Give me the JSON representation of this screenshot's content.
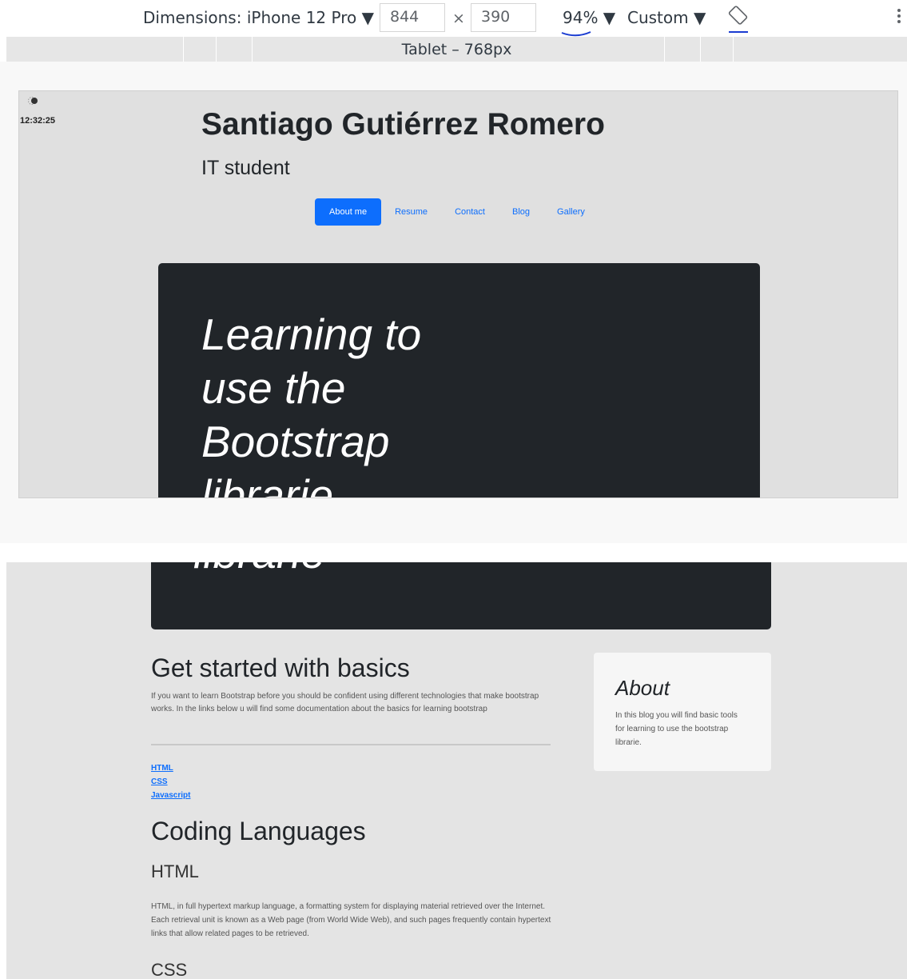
{
  "devtools": {
    "dimensions_label": "Dimensions: iPhone 12 Pro ▼",
    "width_value": "844",
    "times": "×",
    "height_value": "390",
    "zoom_label": "94% ▼",
    "throttle_label": "Custom ▼",
    "media_query_label": "Tablet – 768px",
    "rotate_icon": "rotate-icon",
    "more_icon": "more-vertical-icon",
    "annotation_color": "#1a3cd1"
  },
  "overlay": {
    "time": "12:32:25",
    "icon": "moon-toggle-icon"
  },
  "site": {
    "name": "Santiago Gutiérrez Romero",
    "subtitle": "IT student",
    "nav": [
      {
        "label": "About me",
        "active": true
      },
      {
        "label": "Resume"
      },
      {
        "label": "Contact"
      },
      {
        "label": "Blog"
      },
      {
        "label": "Gallery"
      }
    ],
    "accent": "#0d6efd",
    "hero_text": "Learning to use the Bootstrap librarie",
    "hero_overflow_text": "librarie",
    "hero_bg": "#212529"
  },
  "main": {
    "post_title": "Get started with basics",
    "post_body": "If you want to learn Bootstrap before you should be confident using different technologies that make bootstrap works. In the links below u will find some documentation about the basics for learning bootstrap",
    "links": [
      "HTML",
      "CSS",
      "Javascript"
    ],
    "section_title": "Coding Languages",
    "languages": [
      {
        "title": "HTML",
        "body": "HTML, in full hypertext markup language, a formatting system for displaying material retrieved over the Internet. Each retrieval unit is known as a Web page (from World Wide Web), and such pages frequently contain hypertext links that allow related pages to be retrieved."
      },
      {
        "title": "CSS"
      }
    ]
  },
  "sidebar": {
    "about_title": "About",
    "about_body": "In this blog you will find basic tools for learning to use the bootstrap librarie."
  }
}
